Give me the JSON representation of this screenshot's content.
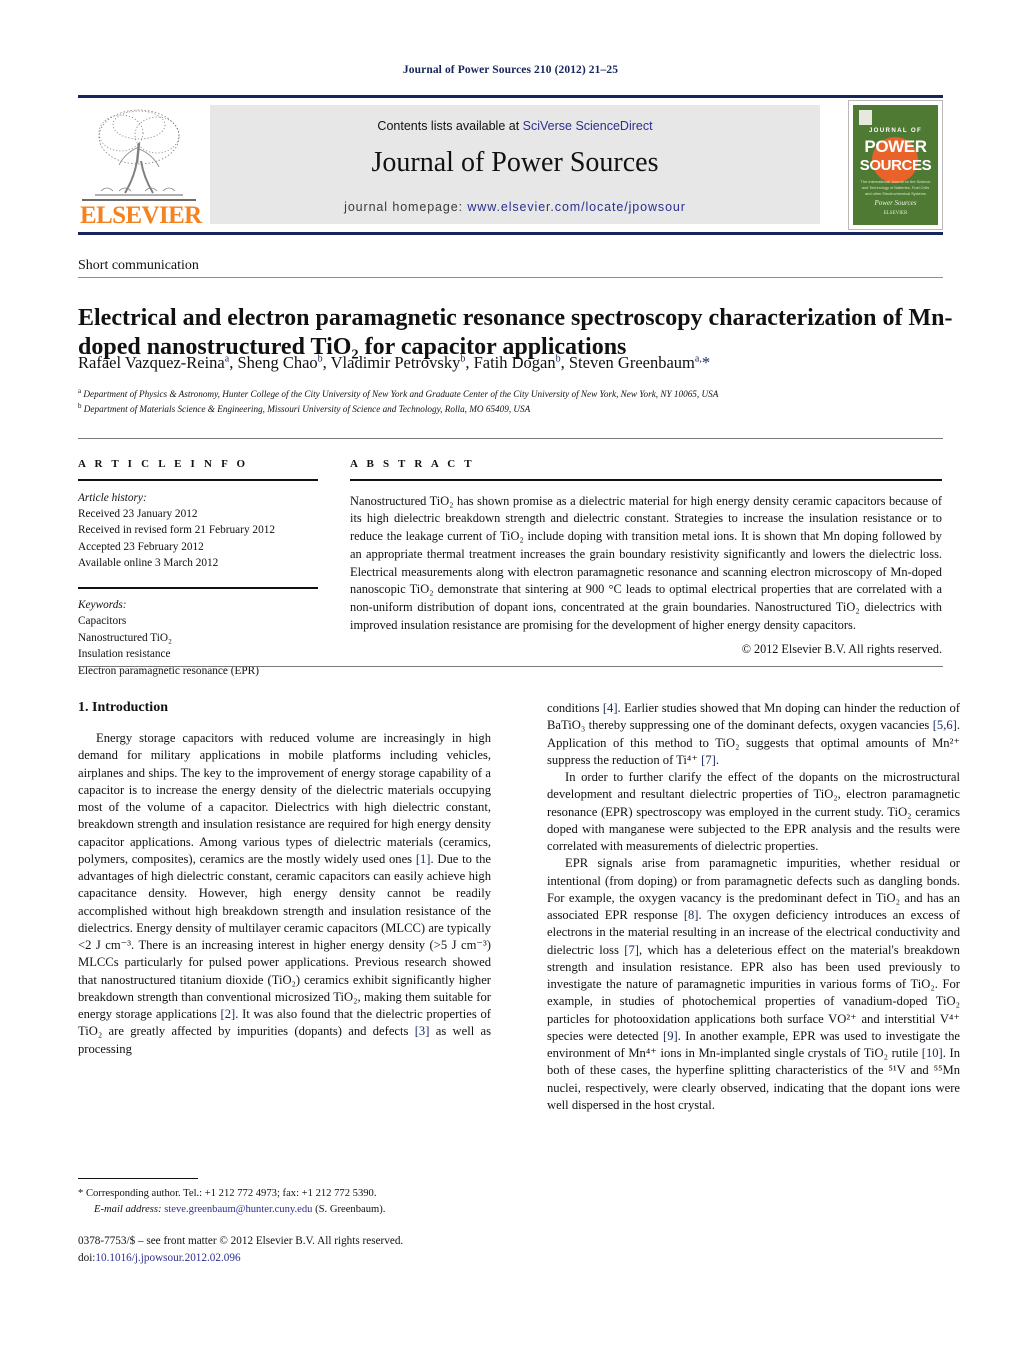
{
  "running_head": "Journal of Power Sources 210 (2012) 21–25",
  "masthead": {
    "contents_prefix": "Contents lists available at ",
    "contents_link": "SciVerse ScienceDirect",
    "journal_title": "Journal of Power Sources",
    "homepage_label": "journal homepage:",
    "homepage_url": "www.elsevier.com/locate/jpowsour",
    "publisher_logo": "ELSEVIER",
    "cover": {
      "line1": "JOURNAL OF",
      "line2": "POWER",
      "line3": "SOURCES",
      "blurb": "The International Journal on the Science and Technology of Batteries, Fuel Cells and other Electrochemical Systems",
      "imprint": "ELSEVIER",
      "scribble": "Power Sources"
    }
  },
  "article": {
    "type": "Short communication",
    "title": "Electrical and electron paramagnetic resonance spectroscopy characterization of Mn-doped nanostructured TiO₂ for capacitor applications",
    "authors_html": "Rafael Vazquez-Reina<sup>a</sup>, Sheng Chao<sup>b</sup>, Vladimir Petrovsky<sup>b</sup>, Fatih Dogan<sup>b</sup>, Steven Greenbaum<sup>a,</sup><span class=\"star\">*</span>",
    "affiliations": [
      "Department of Physics & Astronomy, Hunter College of the City University of New York and Graduate Center of the City University of New York, New York, NY 10065, USA",
      "Department of Materials Science & Engineering, Missouri University of Science and Technology, Rolla, MO 65409, USA"
    ]
  },
  "info": {
    "heading": "A R T I C L E  I N F O",
    "history_label": "Article history:",
    "history": [
      "Received 23 January 2012",
      "Received in revised form 21 February 2012",
      "Accepted 23 February 2012",
      "Available online 3 March 2012"
    ],
    "keywords_label": "Keywords:",
    "keywords": [
      "Capacitors",
      "Nanostructured TiO₂",
      "Insulation resistance",
      "Electron paramagnetic resonance (EPR)"
    ]
  },
  "abstract": {
    "heading": "A B S T R A C T",
    "text": "Nanostructured TiO₂ has shown promise as a dielectric material for high energy density ceramic capacitors because of its high dielectric breakdown strength and dielectric constant. Strategies to increase the insulation resistance or to reduce the leakage current of TiO₂ include doping with transition metal ions. It is shown that Mn doping followed by an appropriate thermal treatment increases the grain boundary resistivity significantly and lowers the dielectric loss. Electrical measurements along with electron paramagnetic resonance and scanning electron microscopy of Mn-doped nanoscopic TiO₂ demonstrate that sintering at 900 °C leads to optimal electrical properties that are correlated with a non-uniform distribution of dopant ions, concentrated at the grain boundaries. Nanostructured TiO₂ dielectrics with improved insulation resistance are promising for the development of higher energy density capacitors.",
    "copyright": "© 2012 Elsevier B.V. All rights reserved."
  },
  "body": {
    "section_heading": "1. Introduction",
    "left_paragraphs": [
      "Energy storage capacitors with reduced volume are increasingly in high demand for military applications in mobile platforms including vehicles, airplanes and ships. The key to the improvement of energy storage capability of a capacitor is to increase the energy density of the dielectric materials occupying most of the volume of a capacitor. Dielectrics with high dielectric constant, breakdown strength and insulation resistance are required for high energy density capacitor applications. Among various types of dielectric materials (ceramics, polymers, composites), ceramics are the mostly widely used ones [1]. Due to the advantages of high dielectric constant, ceramic capacitors can easily achieve high capacitance density. However, high energy density cannot be readily accomplished without high breakdown strength and insulation resistance of the dielectrics. Energy density of multilayer ceramic capacitors (MLCC) are typically <2 J cm⁻³. There is an increasing interest in higher energy density (>5 J cm⁻³) MLCCs particularly for pulsed power applications. Previous research showed that nanostructured titanium dioxide (TiO₂) ceramics exhibit significantly higher breakdown strength than conventional microsized TiO₂, making them suitable for energy storage applications [2]. It was also found that the dielectric properties of TiO₂ are greatly affected by impurities (dopants) and defects [3] as well as processing"
    ],
    "right_paragraphs": [
      "conditions [4]. Earlier studies showed that Mn doping can hinder the reduction of BaTiO₃ thereby suppressing one of the dominant defects, oxygen vacancies [5,6]. Application of this method to TiO₂ suggests that optimal amounts of Mn²⁺ suppress the reduction of Ti⁴⁺ [7].",
      "In order to further clarify the effect of the dopants on the microstructural development and resultant dielectric properties of TiO₂, electron paramagnetic resonance (EPR) spectroscopy was employed in the current study. TiO₂ ceramics doped with manganese were subjected to the EPR analysis and the results were correlated with measurements of dielectric properties.",
      "EPR signals arise from paramagnetic impurities, whether residual or intentional (from doping) or from paramagnetic defects such as dangling bonds. For example, the oxygen vacancy is the predominant defect in TiO₂ and has an associated EPR response [8]. The oxygen deficiency introduces an excess of electrons in the material resulting in an increase of the electrical conductivity and dielectric loss [7], which has a deleterious effect on the material's breakdown strength and insulation resistance. EPR also has been used previously to investigate the nature of paramagnetic impurities in various forms of TiO₂. For example, in studies of photochemical properties of vanadium-doped TiO₂ particles for photooxidation applications both surface VO²⁺ and interstitial V⁴⁺ species were detected [9]. In another example, EPR was used to investigate the environment of Mn⁴⁺ ions in Mn-implanted single crystals of TiO₂ rutile [10]. In both of these cases, the hyperfine splitting characteristics of the ⁵¹V and ⁵⁵Mn nuclei, respectively, were clearly observed, indicating that the dopant ions were well dispersed in the host crystal."
    ]
  },
  "footnote": {
    "corresponding": "* Corresponding author. Tel.: +1 212 772 4973; fax: +1 212 772 5390.",
    "email_label": "E-mail address:",
    "email": "steve.greenbaum@hunter.cuny.edu",
    "email_suffix": "(S. Greenbaum)."
  },
  "imprint": {
    "line1": "0378-7753/$ – see front matter © 2012 Elsevier B.V. All rights reserved.",
    "doi_label": "doi:",
    "doi": "10.1016/j.jpowsour.2012.02.096"
  }
}
